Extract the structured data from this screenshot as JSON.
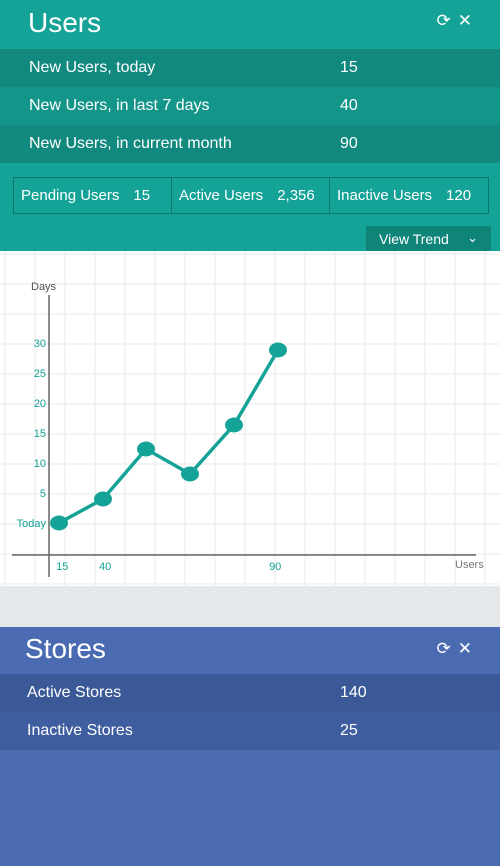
{
  "users": {
    "title": "Users",
    "tools": {
      "refresh": "⟳",
      "close": "✕"
    },
    "rows": [
      {
        "label": "New Users, today",
        "value": "15"
      },
      {
        "label": "New Users, in last 7 days",
        "value": "40"
      },
      {
        "label": "New Users, in current month",
        "value": "90"
      }
    ],
    "summary": [
      {
        "label": "Pending Users",
        "value": "15"
      },
      {
        "label": "Active Users",
        "value": "2,356"
      },
      {
        "label": "Inactive Users",
        "value": "120"
      }
    ],
    "trend_button": {
      "label": "View Trend",
      "chevron": "⌄"
    }
  },
  "chart_data": {
    "type": "line",
    "ylabel": "Days",
    "xlabel": "Users",
    "yticks": [
      {
        "value": 0,
        "label": "Today"
      },
      {
        "value": 5,
        "label": "5"
      },
      {
        "value": 10,
        "label": "10"
      },
      {
        "value": 15,
        "label": "15"
      },
      {
        "value": 20,
        "label": "20"
      },
      {
        "value": 25,
        "label": "25"
      },
      {
        "value": 30,
        "label": "30"
      }
    ],
    "xticks": [
      {
        "value": 15,
        "label": "15"
      },
      {
        "value": 40,
        "label": "40"
      },
      {
        "value": 90,
        "label": "90"
      }
    ],
    "xlim": [
      0,
      150
    ],
    "ylim": [
      -5,
      40
    ],
    "grid": true,
    "line_color": "#14a396",
    "points": [
      {
        "x": 15,
        "y": 0
      },
      {
        "x": 40,
        "y": 4
      },
      {
        "x": 55,
        "y": 12.5
      },
      {
        "x": 70,
        "y": 8.5
      },
      {
        "x": 85,
        "y": 16.5
      },
      {
        "x": 100,
        "y": 29
      }
    ]
  },
  "stores": {
    "title": "Stores",
    "tools": {
      "refresh": "⟳",
      "close": "✕"
    },
    "rows": [
      {
        "label": "Active Stores",
        "value": "140"
      },
      {
        "label": "Inactive Stores",
        "value": "25"
      }
    ]
  }
}
